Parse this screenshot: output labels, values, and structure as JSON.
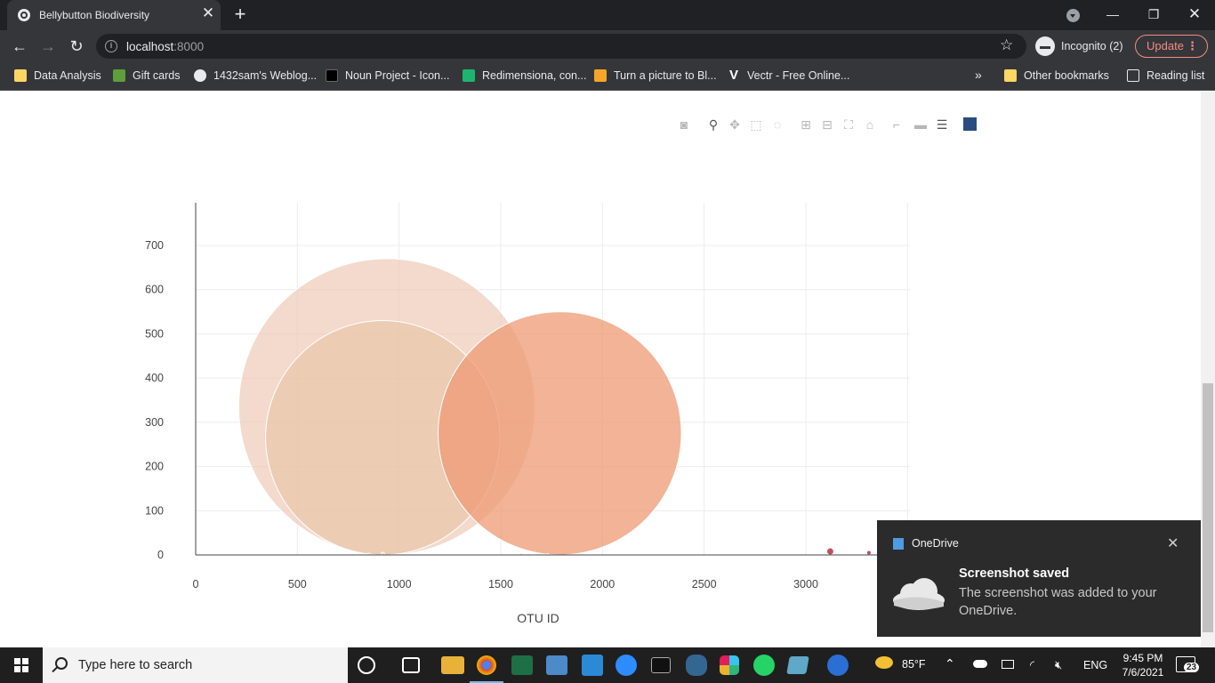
{
  "browser": {
    "tab_title": "Bellybutton Biodiversity",
    "url_host": "localhost",
    "url_port": ":8000",
    "incognito_label": "Incognito (2)",
    "update_label": "Update",
    "bookmarks": [
      {
        "label": "Data Analysis",
        "icon": "folder-icon"
      },
      {
        "label": "Gift cards",
        "icon": "shopify-icon"
      },
      {
        "label": "1432sam's Weblog...",
        "icon": "wordpress-icon"
      },
      {
        "label": "Noun Project - Icon...",
        "icon": "noun-project-icon"
      },
      {
        "label": "Redimensiona, con...",
        "icon": "redimensiona-icon"
      },
      {
        "label": "Turn a picture to Bl...",
        "icon": "picture-icon"
      },
      {
        "label": "Vectr - Free Online...",
        "icon": "vectr-icon"
      }
    ],
    "other_bookmarks": "Other bookmarks",
    "reading_list": "Reading list"
  },
  "chart_data": {
    "type": "scatter",
    "mode": "bubble",
    "title": "",
    "xlabel": "OTU ID",
    "ylabel": "",
    "xlim": [
      0,
      3500
    ],
    "ylim": [
      0,
      800
    ],
    "xticks": [
      0,
      500,
      1000,
      1500,
      2000,
      2500,
      3000
    ],
    "yticks": [
      0,
      100,
      200,
      300,
      400,
      500,
      600,
      700
    ],
    "grid": true,
    "points": [
      {
        "x": 940,
        "y": 335,
        "r": 335,
        "color": "#ecc6b0",
        "opacity": 0.65
      },
      {
        "x": 920,
        "y": 265,
        "r": 265,
        "color": "#e9c6aa",
        "opacity": 0.7
      },
      {
        "x": 1790,
        "y": 275,
        "r": 275,
        "color": "#ee9a74",
        "opacity": 0.75
      },
      {
        "x": 570,
        "y": 1,
        "r": 2,
        "color": "#f0dcc8",
        "opacity": 1
      },
      {
        "x": 680,
        "y": 1,
        "r": 2,
        "color": "#f0dcc8",
        "opacity": 1
      },
      {
        "x": 770,
        "y": 1,
        "r": 2,
        "color": "#f0dcc8",
        "opacity": 1
      },
      {
        "x": 850,
        "y": 1,
        "r": 3,
        "color": "#f0dcc8",
        "opacity": 1
      },
      {
        "x": 920,
        "y": 2,
        "r": 4,
        "color": "#f0dcc8",
        "opacity": 1
      },
      {
        "x": 1600,
        "y": 1,
        "r": 3,
        "color": "#f0dcc8",
        "opacity": 1
      },
      {
        "x": 1640,
        "y": 1,
        "r": 2,
        "color": "#f0dcc8",
        "opacity": 1
      },
      {
        "x": 1730,
        "y": 1,
        "r": 2,
        "color": "#f0dcc8",
        "opacity": 1
      },
      {
        "x": 3120,
        "y": 8,
        "r": 8,
        "color": "#c0505e",
        "opacity": 1
      },
      {
        "x": 3310,
        "y": 5,
        "r": 5,
        "color": "#c0505e",
        "opacity": 1
      }
    ]
  },
  "modebar": [
    "camera-icon",
    "zoom-icon",
    "pan-icon",
    "box-select-icon",
    "lasso-icon",
    "zoom-in-icon",
    "zoom-out-icon",
    "autoscale-icon",
    "reset-axes-icon",
    "spike-lines-icon",
    "hover-closest-icon",
    "hover-compare-icon",
    "plotly-logo-icon"
  ],
  "toast": {
    "app": "OneDrive",
    "title": "Screenshot saved",
    "body": "The screenshot was added to your OneDrive."
  },
  "taskbar": {
    "search_placeholder": "Type here to search",
    "weather": "85°F",
    "language": "ENG",
    "time": "9:45 PM",
    "date": "7/6/2021",
    "notification_count": "23"
  }
}
